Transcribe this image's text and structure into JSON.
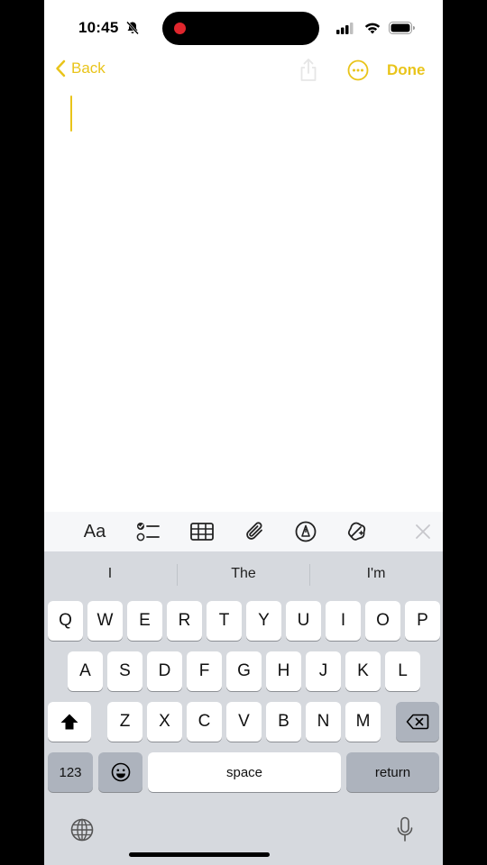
{
  "status_bar": {
    "time": "10:45",
    "icons": [
      "bell-slash-icon",
      "signal-icon",
      "wifi-icon",
      "battery-icon"
    ]
  },
  "nav": {
    "back_label": "Back",
    "done_label": "Done",
    "accent_color": "#e9c41a"
  },
  "toolbar": {
    "aa_label": "Aa",
    "icons": [
      "checklist-icon",
      "table-icon",
      "paperclip-icon",
      "markup-pen-icon",
      "writing-tools-icon",
      "close-icon"
    ]
  },
  "keyboard": {
    "suggestions": [
      "I",
      "The",
      "I'm"
    ],
    "row1": [
      "Q",
      "W",
      "E",
      "R",
      "T",
      "Y",
      "U",
      "I",
      "O",
      "P"
    ],
    "row2": [
      "A",
      "S",
      "D",
      "F",
      "G",
      "H",
      "J",
      "K",
      "L"
    ],
    "row3": [
      "Z",
      "X",
      "C",
      "V",
      "B",
      "N",
      "M"
    ],
    "numbers_label": "123",
    "space_label": "space",
    "return_label": "return"
  }
}
